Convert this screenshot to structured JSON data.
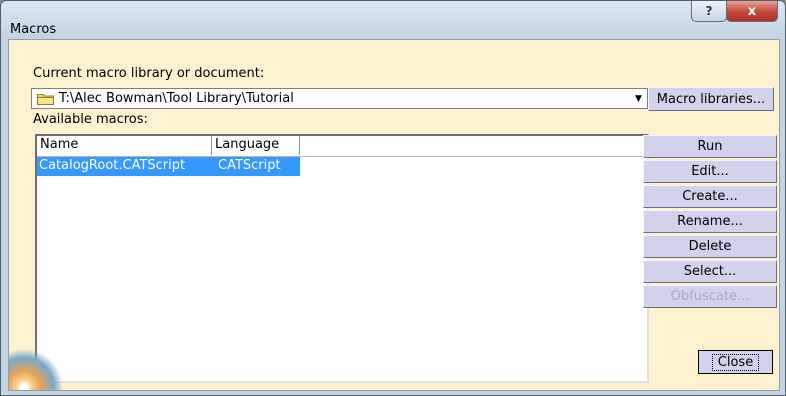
{
  "window": {
    "title": "Macros",
    "help_label": "?",
    "close_label": "x"
  },
  "library": {
    "label": "Current macro library or document:",
    "path": "T:\\Alec Bowman\\Tool Library\\Tutorial",
    "libraries_button": "Macro libraries..."
  },
  "macros": {
    "label": "Available macros:",
    "columns": [
      "Name",
      "Language"
    ],
    "rows": [
      {
        "name": "CatalogRoot.CATScript",
        "language": "CATScript"
      }
    ]
  },
  "actions": {
    "run": "Run",
    "edit": "Edit...",
    "create": "Create...",
    "rename": "Rename...",
    "delete": "Delete",
    "select": "Select...",
    "obfuscate": "Obfuscate..."
  },
  "footer": {
    "close": "Close"
  },
  "colors": {
    "dialog_background": "#fdf2cf",
    "button_face": "#d3d2ec",
    "selection": "#3399ff",
    "title_close": "#c2483a"
  },
  "icons": {
    "library": "folder-icon",
    "dropdown": "dropdown-arrow-icon"
  }
}
